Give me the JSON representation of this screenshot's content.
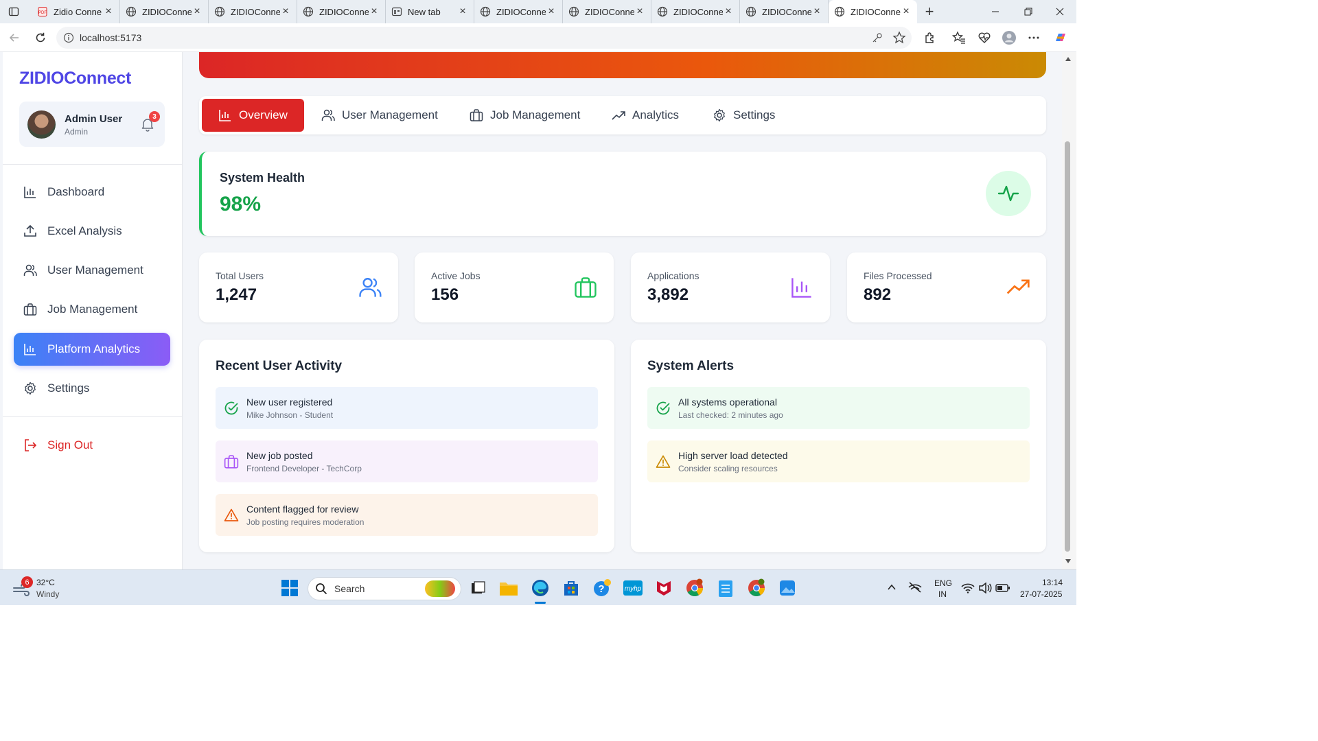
{
  "browser": {
    "tabs": [
      {
        "label": "Zidio Conne",
        "icon": "pdf-icon"
      },
      {
        "label": "ZIDIOConne",
        "icon": "globe-icon"
      },
      {
        "label": "ZIDIOConne",
        "icon": "globe-icon"
      },
      {
        "label": "ZIDIOConne",
        "icon": "globe-icon"
      },
      {
        "label": "New tab",
        "icon": "newtab-icon"
      },
      {
        "label": "ZIDIOConne",
        "icon": "globe-icon"
      },
      {
        "label": "ZIDIOConne",
        "icon": "globe-icon"
      },
      {
        "label": "ZIDIOConne",
        "icon": "globe-icon"
      },
      {
        "label": "ZIDIOConne",
        "icon": "globe-icon"
      },
      {
        "label": "ZIDIOConne",
        "icon": "globe-icon",
        "active": true
      }
    ],
    "url": "localhost:5173"
  },
  "sidebar": {
    "brand": "ZIDIOConnect",
    "user": {
      "name": "Admin User",
      "role": "Admin",
      "notifications": "3"
    },
    "items": [
      {
        "label": "Dashboard",
        "icon": "bar-chart-icon"
      },
      {
        "label": "Excel Analysis",
        "icon": "upload-icon"
      },
      {
        "label": "User Management",
        "icon": "users-icon"
      },
      {
        "label": "Job Management",
        "icon": "briefcase-icon"
      },
      {
        "label": "Platform Analytics",
        "icon": "bar-chart-icon",
        "active": true
      },
      {
        "label": "Settings",
        "icon": "gear-icon"
      }
    ],
    "signout": "Sign Out"
  },
  "main": {
    "tabs": [
      {
        "label": "Overview",
        "icon": "bar-chart-icon",
        "active": true
      },
      {
        "label": "User Management",
        "icon": "users-icon"
      },
      {
        "label": "Job Management",
        "icon": "briefcase-icon"
      },
      {
        "label": "Analytics",
        "icon": "trending-up-icon"
      },
      {
        "label": "Settings",
        "icon": "gear-icon"
      }
    ],
    "health": {
      "title": "System Health",
      "value": "98%"
    },
    "stats": [
      {
        "label": "Total Users",
        "value": "1,247",
        "icon": "users-icon",
        "color": "#3b82f6"
      },
      {
        "label": "Active Jobs",
        "value": "156",
        "icon": "briefcase-icon",
        "color": "#22c55e"
      },
      {
        "label": "Applications",
        "value": "3,892",
        "icon": "bar-chart-icon",
        "color": "#a855f7"
      },
      {
        "label": "Files Processed",
        "value": "892",
        "icon": "trending-up-icon",
        "color": "#f97316"
      }
    ],
    "activity": {
      "title": "Recent User Activity",
      "items": [
        {
          "title": "New user registered",
          "subtitle": "Mike Johnson - Student",
          "bg": "#eef4fd",
          "color": "#16a34a"
        },
        {
          "title": "New job posted",
          "subtitle": "Frontend Developer - TechCorp",
          "bg": "#f8f1fc",
          "color": "#a855f7"
        },
        {
          "title": "Content flagged for review",
          "subtitle": "Job posting requires moderation",
          "bg": "#fdf3ea",
          "color": "#ea580c"
        }
      ]
    },
    "alerts": {
      "title": "System Alerts",
      "items": [
        {
          "title": "All systems operational",
          "subtitle": "Last checked: 2 minutes ago",
          "bg": "#eefbf2",
          "color": "#16a34a"
        },
        {
          "title": "High server load detected",
          "subtitle": "Consider scaling resources",
          "bg": "#fdfaea",
          "color": "#ca8a04"
        }
      ]
    }
  },
  "taskbar": {
    "weather": {
      "temp": "32°C",
      "desc": "Windy",
      "badge": "6"
    },
    "search_placeholder": "Search",
    "lang": "ENG",
    "region": "IN",
    "time": "13:14",
    "date": "27-07-2025"
  }
}
